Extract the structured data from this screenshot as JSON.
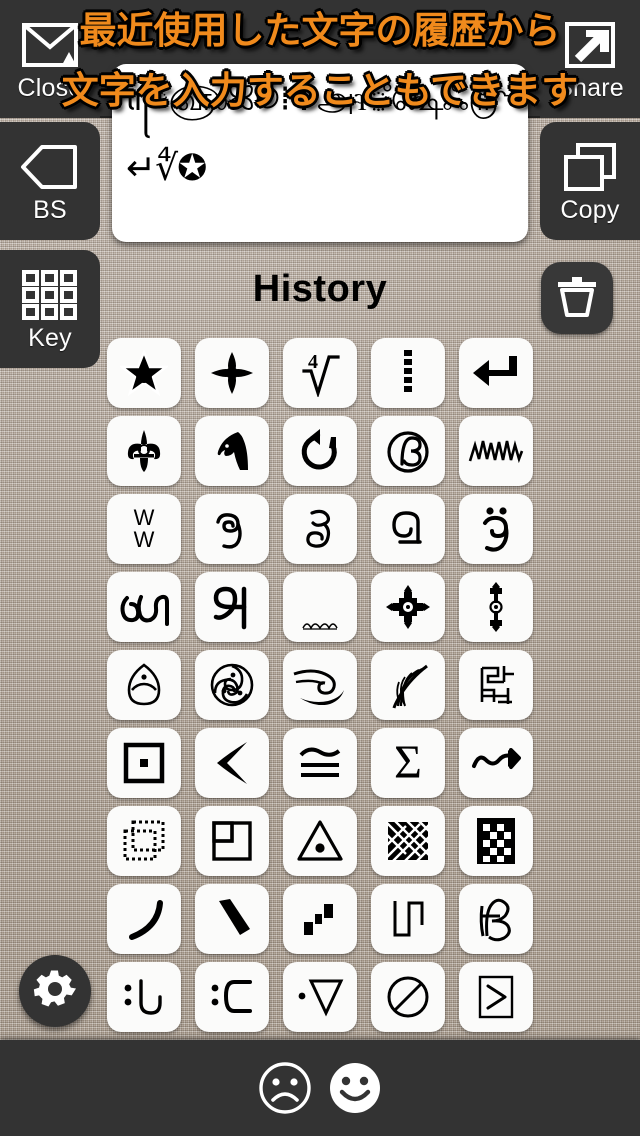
{
  "app": {
    "title": "History",
    "background": "#ada095",
    "accent": "#f08a1c",
    "panel_color": "#333333",
    "cell_color": "#fbfbfa"
  },
  "overlay": {
    "line1": "最近使用した文字の履歴から",
    "line2": "文字を入力することもできます",
    "color": "#f08a1c",
    "outline": "#000000"
  },
  "toolbar": {
    "close_label": "Close",
    "share_label": "Share",
    "bs_label": "BS",
    "copy_label": "Copy",
    "key_label": "Key",
    "close_icon": "envelope-close-icon",
    "share_icon": "share-arrow-icon",
    "bs_icon": "backspace-icon",
    "copy_icon": "copy-icon",
    "key_icon": "keypad-grid-icon",
    "trash_icon": "trash-icon",
    "settings_icon": "gear-icon"
  },
  "text_display": {
    "line1": "ꦺ௵ꕤꖴ⁞✛அꮈஂ௸ஃ௹ᵂ〰ⓑᎧ",
    "line2": "↵∜✪",
    "placeholder": ""
  },
  "history": {
    "title": "History",
    "columns": 5,
    "rows": 9,
    "cells": [
      {
        "name": "glyph-star-circle",
        "icon": "star-with-circle-icon"
      },
      {
        "name": "glyph-floral-cross",
        "icon": "floral-cross-icon"
      },
      {
        "name": "glyph-fourth-root",
        "icon": "fourth-root-icon"
      },
      {
        "name": "glyph-dotted-vertical",
        "icon": "dotted-vertical-line-icon"
      },
      {
        "name": "glyph-return-arrow",
        "icon": "return-arrow-icon"
      },
      {
        "name": "glyph-fleur-de-lis",
        "icon": "fleur-de-lis-icon"
      },
      {
        "name": "glyph-chess-knight",
        "icon": "chess-knight-icon"
      },
      {
        "name": "glyph-anticlockwise-arrow",
        "icon": "anticlockwise-circle-arrow-icon"
      },
      {
        "name": "glyph-circled-b",
        "icon": "circled-b-icon"
      },
      {
        "name": "glyph-zigzag",
        "icon": "zigzag-line-icon"
      },
      {
        "name": "glyph-double-w",
        "icon": "double-w-icon"
      },
      {
        "name": "glyph-kannada-ja",
        "icon": "kannada-ja-icon"
      },
      {
        "name": "glyph-kannada-tta",
        "icon": "kannada-tta-icon"
      },
      {
        "name": "glyph-kannada-da",
        "icon": "kannada-da-icon"
      },
      {
        "name": "glyph-kannada-uu-diaeresis",
        "icon": "kannada-uu-diaeresis-icon"
      },
      {
        "name": "glyph-tamil-sha",
        "icon": "tamil-sha-icon"
      },
      {
        "name": "glyph-tamil-a",
        "icon": "tamil-a-icon"
      },
      {
        "name": "glyph-small-ornament",
        "icon": "small-ornament-icon"
      },
      {
        "name": "glyph-ornate-cross",
        "icon": "ornate-cross-icon"
      },
      {
        "name": "glyph-vertical-ornament",
        "icon": "vertical-ornament-icon"
      },
      {
        "name": "glyph-egg-eye",
        "icon": "egg-with-dot-icon"
      },
      {
        "name": "glyph-triskelion",
        "icon": "triskelion-spiral-icon"
      },
      {
        "name": "glyph-wind-swirl",
        "icon": "wind-swirl-icon"
      },
      {
        "name": "glyph-feather-plume",
        "icon": "feather-plume-icon"
      },
      {
        "name": "glyph-angular-maze",
        "icon": "angular-maze-icon"
      },
      {
        "name": "glyph-square-dot",
        "icon": "square-with-dot-icon"
      },
      {
        "name": "glyph-curved-less-than",
        "icon": "curved-less-than-icon"
      },
      {
        "name": "glyph-approx-equal-triple",
        "icon": "approximately-equal-icon"
      },
      {
        "name": "glyph-sigma",
        "icon": "sigma-icon"
      },
      {
        "name": "glyph-wavy-arrow",
        "icon": "wavy-arrow-icon"
      },
      {
        "name": "glyph-dotted-squares",
        "icon": "dotted-overlapping-squares-icon"
      },
      {
        "name": "glyph-nested-square",
        "icon": "nested-square-icon"
      },
      {
        "name": "glyph-triangle-dot",
        "icon": "triangle-with-dot-icon"
      },
      {
        "name": "glyph-lattice",
        "icon": "lattice-mesh-icon"
      },
      {
        "name": "glyph-checkered-block",
        "icon": "checkered-block-icon"
      },
      {
        "name": "glyph-arc-curve",
        "icon": "arc-curve-icon"
      },
      {
        "name": "glyph-diagonal-stroke",
        "icon": "diagonal-stroke-icon"
      },
      {
        "name": "glyph-three-blocks",
        "icon": "three-blocks-icon"
      },
      {
        "name": "glyph-step-wave",
        "icon": "step-square-wave-icon"
      },
      {
        "name": "glyph-hb-monogram",
        "icon": "hb-monogram-icon"
      },
      {
        "name": "glyph-smiley-colon-l",
        "icon": "smiley-colon-l-icon"
      },
      {
        "name": "glyph-frown-colon-c",
        "icon": "frown-colon-c-icon"
      },
      {
        "name": "glyph-dot-triangle-down",
        "icon": "dot-triangle-down-icon"
      },
      {
        "name": "glyph-circle-slash",
        "icon": "circle-with-slash-icon"
      },
      {
        "name": "glyph-boxed-greater-than",
        "icon": "boxed-greater-than-icon"
      }
    ]
  },
  "bottom_bar": {
    "sad_icon": "sad-face-icon",
    "happy_icon": "happy-face-icon"
  }
}
